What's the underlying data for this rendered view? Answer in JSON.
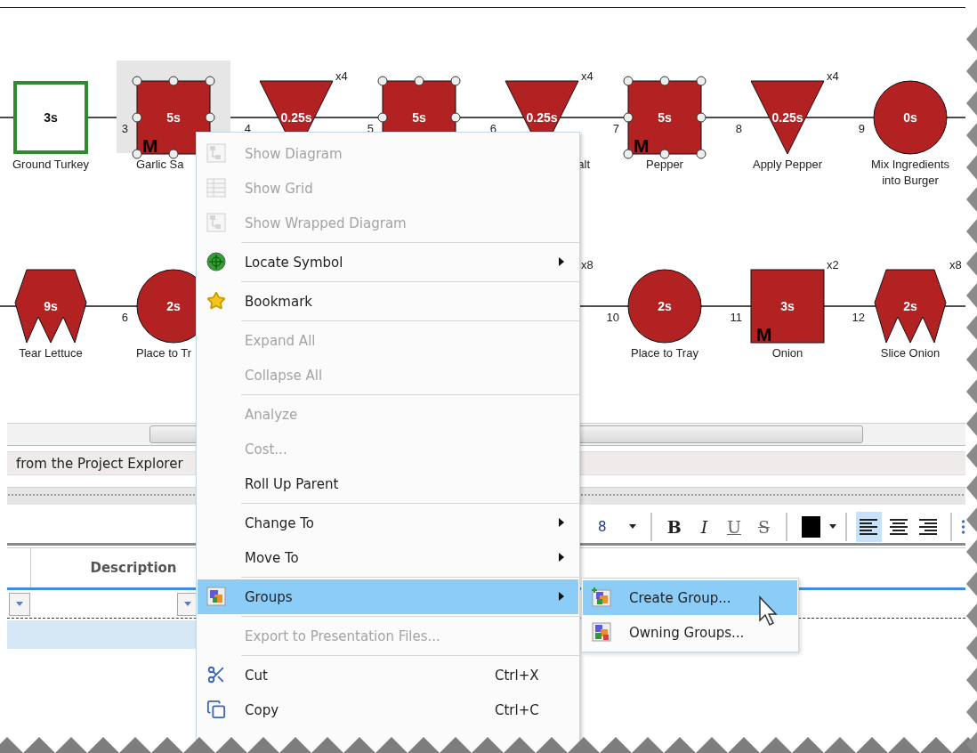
{
  "diagram": {
    "rows": [
      {
        "nodes": [
          {
            "kind": "outlined",
            "time": "3s",
            "label": "Ground Turkey",
            "selected": false,
            "focused": false
          },
          {
            "kind": "square",
            "step": "3",
            "time": "5s",
            "mark": "M",
            "label": "Garlic Sa",
            "label_end_hidden": true,
            "selected": true,
            "focused": true
          },
          {
            "kind": "triangle",
            "step": "4",
            "time": "0.25s",
            "count": "x4",
            "selected": false,
            "focused": false
          },
          {
            "kind": "square",
            "step": "5",
            "time": "5s",
            "selected": true,
            "focused": false
          },
          {
            "kind": "triangle",
            "step": "6",
            "time": "0.25s",
            "count": "x4",
            "label": "alt",
            "label_start_hidden": true,
            "selected": false,
            "focused": false
          },
          {
            "kind": "square",
            "step": "7",
            "time": "5s",
            "mark": "M",
            "label": "Pepper",
            "selected": true,
            "focused": false
          },
          {
            "kind": "triangle",
            "step": "8",
            "time": "0.25s",
            "count": "x4",
            "label": "Apply Pepper",
            "selected": false,
            "focused": false
          },
          {
            "kind": "circle",
            "step": "9",
            "time": "0s",
            "label": "Mix Ingredients\ninto Burger",
            "selected": false,
            "focused": false
          }
        ]
      },
      {
        "nodes": [
          {
            "kind": "crown",
            "time": "9s",
            "label": "Tear Lettuce",
            "selected": false,
            "focused": false
          },
          {
            "kind": "circle",
            "step": "6",
            "time": "2s",
            "label": "Place to Tr",
            "label_end_hidden": true,
            "selected": false,
            "focused": false
          },
          {
            "kind": "covered"
          },
          {
            "kind": "covered"
          },
          {
            "kind": "covered",
            "count": "x8"
          },
          {
            "kind": "circle",
            "step": "10",
            "time": "2s",
            "label": "Place to Tray",
            "selected": false,
            "focused": false
          },
          {
            "kind": "square",
            "step": "11",
            "time": "3s",
            "mark": "M",
            "count": "x2",
            "label": "Onion",
            "selected": false,
            "focused": false
          },
          {
            "kind": "crown",
            "step": "12",
            "time": "2s",
            "count": "x8",
            "label": "Slice Onion",
            "selected": false,
            "focused": false
          }
        ]
      }
    ]
  },
  "status_bar": {
    "text": "from the Project Explorer"
  },
  "toolbar": {
    "items": [
      {
        "kind": "size",
        "value": "8"
      },
      {
        "kind": "separator"
      },
      {
        "kind": "bold",
        "label": "B",
        "selected": false
      },
      {
        "kind": "italic",
        "label": "I",
        "selected": false
      },
      {
        "kind": "underline",
        "label": "U",
        "selected": false
      },
      {
        "kind": "strike",
        "label": "S",
        "selected": false
      },
      {
        "kind": "separator"
      },
      {
        "kind": "color",
        "color": "#000000"
      },
      {
        "kind": "separator"
      },
      {
        "kind": "alignleft",
        "selected": true
      },
      {
        "kind": "aligncenter",
        "selected": false
      },
      {
        "kind": "alignright",
        "selected": false
      },
      {
        "kind": "separator"
      },
      {
        "kind": "more"
      }
    ]
  },
  "grid": {
    "columns": [
      "Description"
    ],
    "rows": [
      {
        "selected": true
      }
    ]
  },
  "menu": {
    "items": [
      {
        "kind": "item",
        "label": "Show Diagram",
        "disabled": true,
        "selected": false,
        "submenu": false
      },
      {
        "kind": "item",
        "label": "Show Grid",
        "disabled": true,
        "selected": false,
        "submenu": false
      },
      {
        "kind": "item",
        "label": "Show Wrapped Diagram",
        "disabled": true,
        "selected": false,
        "submenu": false
      },
      {
        "kind": "separator"
      },
      {
        "kind": "item",
        "label": "Locate Symbol",
        "disabled": false,
        "selected": false,
        "submenu": true
      },
      {
        "kind": "separator"
      },
      {
        "kind": "item",
        "label": "Bookmark",
        "disabled": false,
        "selected": false,
        "submenu": false
      },
      {
        "kind": "separator"
      },
      {
        "kind": "item",
        "label": "Expand All",
        "disabled": true,
        "selected": false,
        "submenu": false
      },
      {
        "kind": "item",
        "label": "Collapse All",
        "disabled": true,
        "selected": false,
        "submenu": false
      },
      {
        "kind": "separator"
      },
      {
        "kind": "item",
        "label": "Analyze",
        "disabled": true,
        "selected": false,
        "submenu": false
      },
      {
        "kind": "item",
        "label": "Cost...",
        "disabled": true,
        "selected": false,
        "submenu": false
      },
      {
        "kind": "item",
        "label": "Roll Up Parent",
        "disabled": false,
        "selected": false,
        "submenu": false
      },
      {
        "kind": "separator"
      },
      {
        "kind": "item",
        "label": "Change To",
        "disabled": false,
        "selected": false,
        "submenu": true
      },
      {
        "kind": "item",
        "label": "Move To",
        "disabled": false,
        "selected": false,
        "submenu": true
      },
      {
        "kind": "separator"
      },
      {
        "kind": "item",
        "label": "Groups",
        "disabled": false,
        "selected": true,
        "submenu": true
      },
      {
        "kind": "separator"
      },
      {
        "kind": "item",
        "label": "Export to Presentation Files...",
        "disabled": true,
        "selected": false,
        "submenu": false
      },
      {
        "kind": "separator"
      },
      {
        "kind": "item",
        "label": "Cut",
        "shortcut": "Ctrl+X",
        "disabled": false,
        "selected": false,
        "submenu": false
      },
      {
        "kind": "item",
        "label": "Copy",
        "shortcut": "Ctrl+C",
        "disabled": false,
        "selected": false,
        "submenu": false
      }
    ]
  },
  "submenu": {
    "items": [
      {
        "label": "Create Group...",
        "selected": true
      },
      {
        "label": "Owning Groups...",
        "selected": false
      }
    ]
  }
}
